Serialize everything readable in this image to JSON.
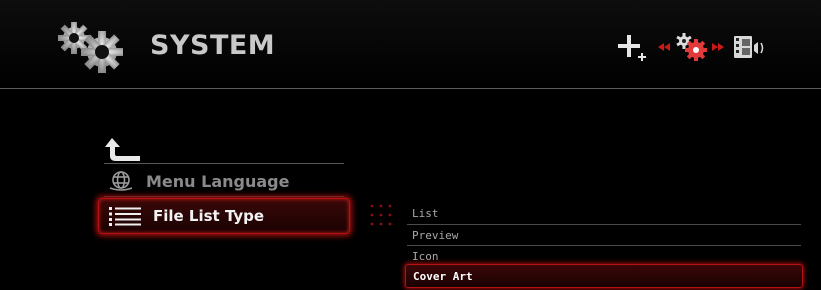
{
  "header": {
    "title": "SYSTEM",
    "icons": [
      "settings-gears-icon",
      "add-icon",
      "active-settings-icon",
      "movie-audio-icon"
    ]
  },
  "menu": {
    "back_icon": "back-arrow-icon",
    "items": [
      {
        "label": "Menu Language",
        "icon": "globe-icon",
        "selected": false
      },
      {
        "label": "File List Type",
        "icon": "list-icon",
        "selected": true
      }
    ]
  },
  "options": {
    "items": [
      "List",
      "Preview",
      "Icon",
      "Cover Art"
    ],
    "selected": "Cover Art"
  },
  "colors": {
    "accent": "#b31212",
    "background": "#000000",
    "text": "#e8e8e8"
  }
}
